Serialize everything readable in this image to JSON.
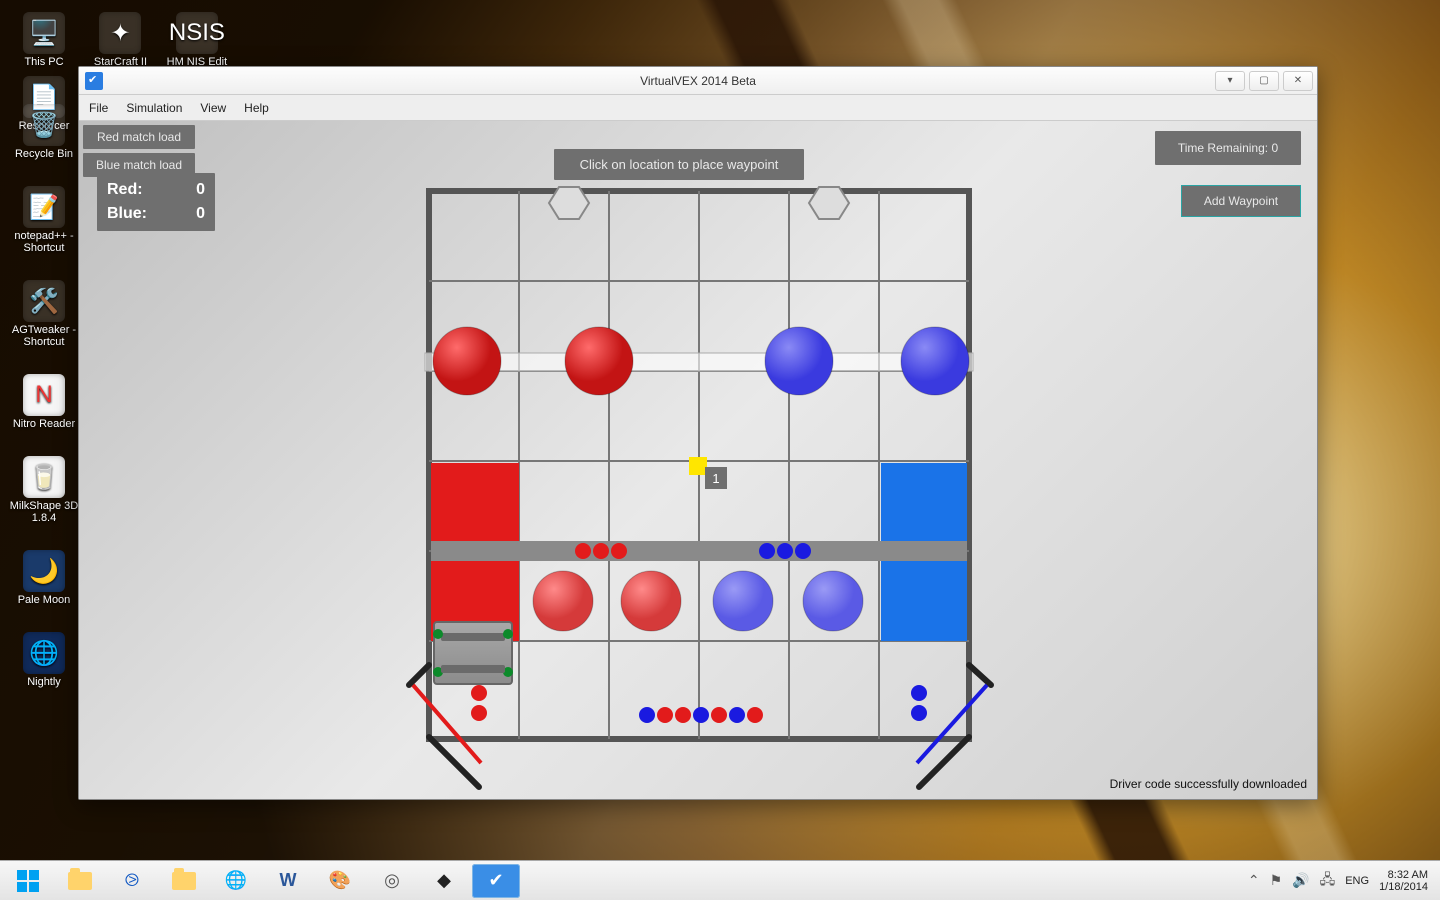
{
  "window": {
    "title": "VirtualVEX 2014 Beta",
    "menu": {
      "file": "File",
      "simulation": "Simulation",
      "view": "View",
      "help": "Help"
    },
    "status": "Driver code successfully downloaded"
  },
  "score": {
    "red_label": "Red:",
    "red_value": "0",
    "blue_label": "Blue:",
    "blue_value": "0"
  },
  "buttons": {
    "red_match_load": "Red match load",
    "blue_match_load": "Blue match load",
    "add_waypoint": "Add Waypoint"
  },
  "hint": "Click on location to place waypoint",
  "timer": {
    "label": "Time Remaining:",
    "value": "0"
  },
  "waypoint_marker": {
    "label": "1"
  },
  "desktop_icons_row": [
    {
      "name": "This PC"
    },
    {
      "name": "StarCraft II"
    },
    {
      "name": "HM NIS Edit"
    },
    {
      "name": "Resourcer"
    }
  ],
  "desktop_icons_col": [
    {
      "name": "Recycle Bin"
    },
    {
      "name": "notepad++ - Shortcut"
    },
    {
      "name": "AGTweaker - Shortcut"
    },
    {
      "name": "Nitro Reader"
    },
    {
      "name": "MilkShape 3D 1.8.4"
    },
    {
      "name": "Pale Moon"
    },
    {
      "name": "Nightly"
    }
  ],
  "tray": {
    "lang": "ENG",
    "time": "8:32 AM",
    "date": "1/18/2014"
  }
}
